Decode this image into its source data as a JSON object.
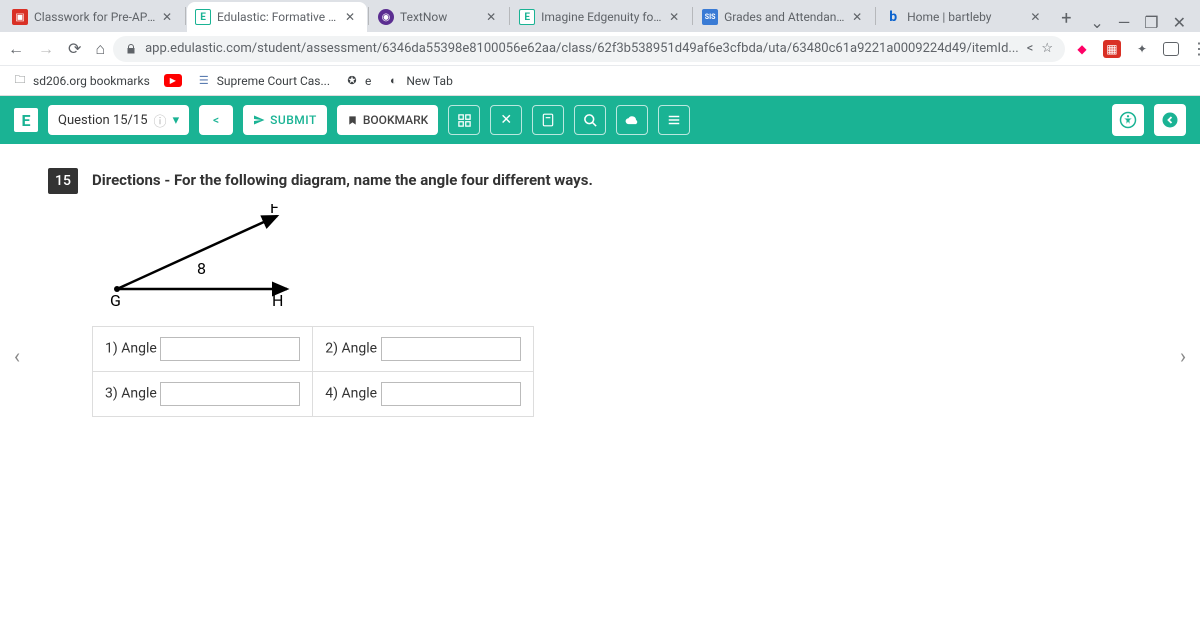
{
  "tabs": [
    {
      "label": "Classwork for Pre-AP G",
      "favicon_bg": "#d93025",
      "favicon_fg": "#fff",
      "favicon_text": "▣",
      "closeable": true
    },
    {
      "label": "Edulastic: Formative an",
      "favicon_bg": "#fff",
      "favicon_fg": "#1ab394",
      "favicon_text": "E",
      "closeable": true,
      "active": true
    },
    {
      "label": "TextNow",
      "favicon_bg": "#5b2e91",
      "favicon_fg": "#fff",
      "favicon_text": "◉",
      "closeable": true
    },
    {
      "label": "Imagine Edgenuity for S",
      "favicon_bg": "#fff",
      "favicon_fg": "#1ab394",
      "favicon_text": "E",
      "closeable": true
    },
    {
      "label": "Grades and Attendance",
      "favicon_bg": "#3a7bd5",
      "favicon_fg": "#fff",
      "favicon_text": "SIS",
      "closeable": true
    },
    {
      "label": "Home | bartleby",
      "favicon_bg": "#fff",
      "favicon_fg": "#0b63ce",
      "favicon_text": "b",
      "closeable": true
    }
  ],
  "url": "app.edulastic.com/student/assessment/6346da55398e8100056e62aa/class/62f3b538951d49af6e3cfbda/uta/63480c61a9221a0009224d49/itemId...",
  "bookmarks": [
    {
      "label": "sd206.org bookmarks",
      "icon": "📁",
      "color": "#5f6368"
    },
    {
      "label": "",
      "icon": "▶",
      "color": "#f00",
      "bg": "#f00"
    },
    {
      "label": "Supreme Court Cas...",
      "icon": "☰",
      "color": "#5b7db1"
    },
    {
      "label": "e",
      "icon": "✪",
      "color": "#888"
    },
    {
      "label": "New Tab",
      "icon": "◐",
      "color": "#333"
    }
  ],
  "header": {
    "logo": "E",
    "question_indicator": "Question 15/15",
    "prev_label": "<",
    "submit_label": "SUBMIT",
    "bookmark_label": "BOOKMARK"
  },
  "question": {
    "number": "15",
    "directions": "Directions - For the following diagram, name the angle four different ways.",
    "labels": {
      "F": "F",
      "G": "G",
      "H": "H",
      "eight": "8"
    },
    "answers": [
      {
        "label": "1) Angle",
        "value": ""
      },
      {
        "label": "2) Angle",
        "value": ""
      },
      {
        "label": "3) Angle",
        "value": ""
      },
      {
        "label": "4) Angle",
        "value": ""
      }
    ]
  }
}
